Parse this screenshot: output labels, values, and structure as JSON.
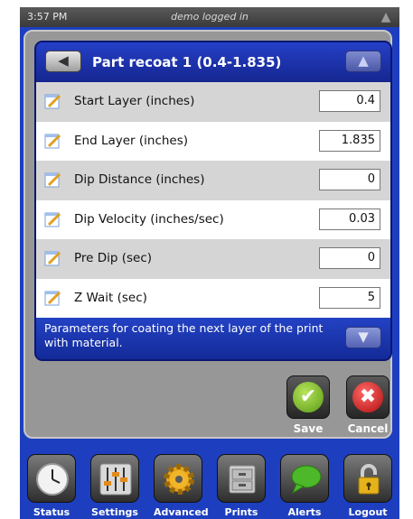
{
  "status_bar": {
    "time": "3:57 PM",
    "center_text": "demo logged in"
  },
  "dialog": {
    "title": "Part recoat 1 (0.4-1.835)",
    "rows": [
      {
        "label": "Start Layer (inches)",
        "value": "0.4"
      },
      {
        "label": "End Layer (inches)",
        "value": "1.835"
      },
      {
        "label": "Dip Distance (inches)",
        "value": "0"
      },
      {
        "label": "Dip Velocity (inches/sec)",
        "value": "0.03"
      },
      {
        "label": "Pre Dip (sec)",
        "value": "0"
      },
      {
        "label": "Z Wait (sec)",
        "value": "5"
      }
    ],
    "footer_text": "Parameters for coating the next layer of the print with material."
  },
  "actions": {
    "save_label": "Save",
    "cancel_label": "Cancel"
  },
  "nav": [
    {
      "label": "Status",
      "icon": "clock-icon"
    },
    {
      "label": "Settings",
      "icon": "sliders-icon"
    },
    {
      "label": "Advanced",
      "icon": "gear-icon"
    },
    {
      "label": "Prints",
      "icon": "file-cabinet-icon"
    },
    {
      "label": "Alerts",
      "icon": "speech-bubble-icon"
    },
    {
      "label": "Logout",
      "icon": "padlock-icon"
    }
  ],
  "colors": {
    "background_blue": "#1d3fbf",
    "panel_gray": "#979797",
    "row_gray": "#d5d5d5",
    "save_green": "#5a9a16",
    "cancel_red": "#b00c0c"
  }
}
